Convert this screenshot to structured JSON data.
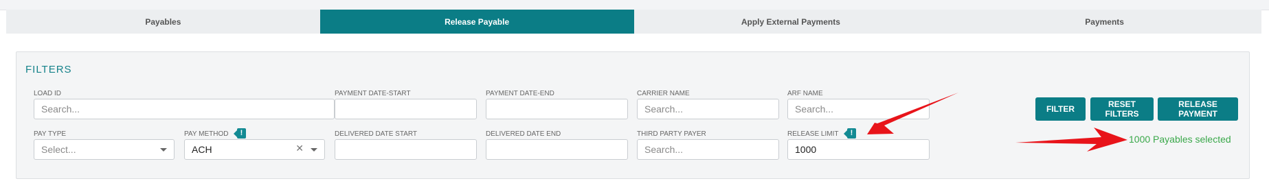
{
  "tabs": [
    {
      "label": "Payables"
    },
    {
      "label": "Release Payable"
    },
    {
      "label": "Apply External Payments"
    },
    {
      "label": "Payments"
    }
  ],
  "filters": {
    "title": "FILTERS",
    "load_id": {
      "label": "LOAD ID",
      "placeholder": "Search..."
    },
    "payment_date_start": {
      "label": "PAYMENT DATE-START",
      "value": ""
    },
    "payment_date_end": {
      "label": "PAYMENT DATE-END",
      "value": ""
    },
    "carrier_name": {
      "label": "CARRIER NAME",
      "placeholder": "Search..."
    },
    "arf_name": {
      "label": "ARF NAME",
      "placeholder": "Search..."
    },
    "pay_type": {
      "label": "PAY TYPE",
      "placeholder": "Select..."
    },
    "pay_method": {
      "label": "PAY METHOD",
      "value": "ACH",
      "badge": "!"
    },
    "delivered_date_start": {
      "label": "DELIVERED DATE START",
      "value": ""
    },
    "delivered_date_end": {
      "label": "DELIVERED DATE END",
      "value": ""
    },
    "third_party_payer": {
      "label": "THIRD PARTY PAYER",
      "placeholder": "Search..."
    },
    "release_limit": {
      "label": "RELEASE LIMIT",
      "value": "1000",
      "badge": "!"
    }
  },
  "actions": {
    "filter": "FILTER",
    "reset_filters": "RESET FILTERS",
    "release_payment": "RELEASE PAYMENT"
  },
  "status": {
    "selected_text": "1000 Payables selected"
  },
  "icons": {
    "clear": "close-icon",
    "caret": "chevron-down-icon",
    "badge": "info-icon",
    "annotation": "red-arrow"
  },
  "colors": {
    "accent": "#0b7d86",
    "success": "#3aa84a",
    "annotation": "#e8141a"
  }
}
